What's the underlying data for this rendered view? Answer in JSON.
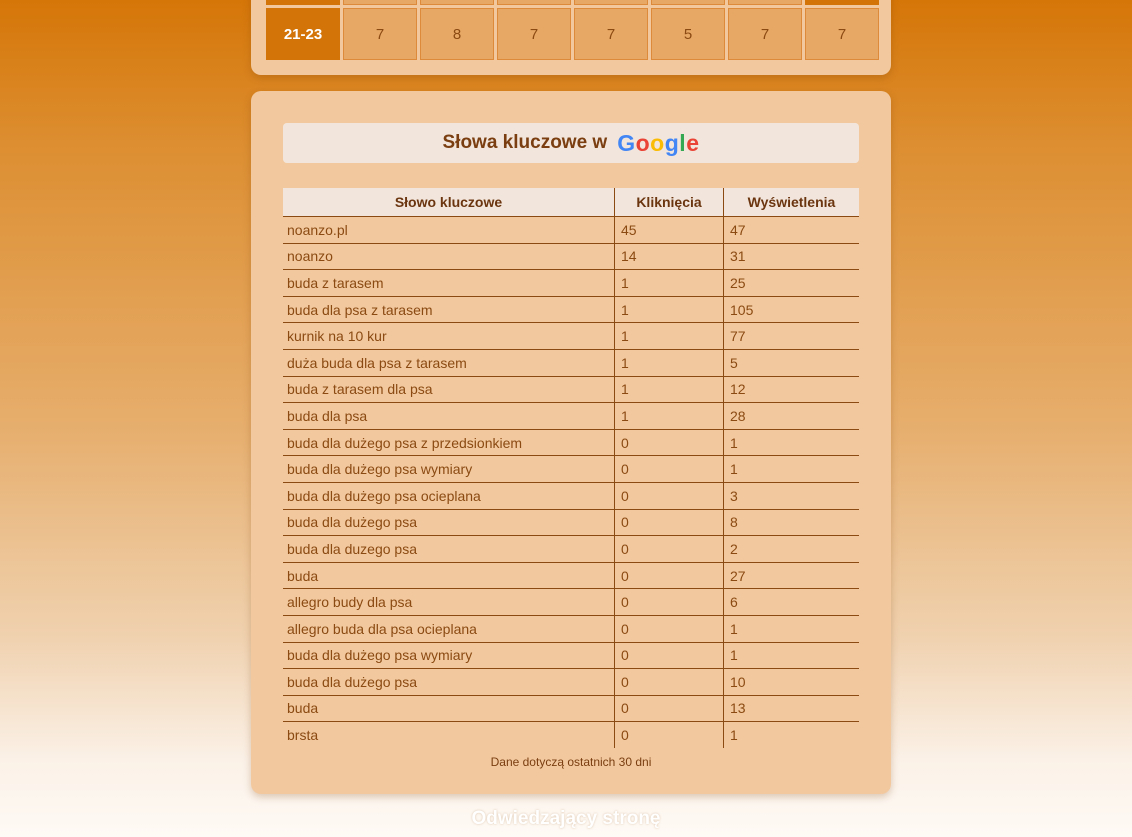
{
  "hours_panel": {
    "last_row": {
      "label": "21-23",
      "values": [
        "7",
        "8",
        "7",
        "7",
        "5",
        "7",
        "7"
      ]
    }
  },
  "keywords": {
    "title_prefix": "Słowa kluczowe w",
    "brand_letters": [
      "G",
      "o",
      "o",
      "g",
      "l",
      "e"
    ],
    "columns": [
      "Słowo kluczowe",
      "Kliknięcia",
      "Wyświetlenia"
    ],
    "rows": [
      [
        "noanzo.pl",
        "45",
        "47"
      ],
      [
        "noanzo",
        "14",
        "31"
      ],
      [
        "buda z tarasem",
        "1",
        "25"
      ],
      [
        "buda dla psa z tarasem",
        "1",
        "105"
      ],
      [
        "kurnik na 10 kur",
        "1",
        "77"
      ],
      [
        "duża buda dla psa z tarasem",
        "1",
        "5"
      ],
      [
        "buda z tarasem dla psa",
        "1",
        "12"
      ],
      [
        "buda dla psa",
        "1",
        "28"
      ],
      [
        "buda dla dużego psa z przedsionkiem",
        "0",
        "1"
      ],
      [
        "buda dla dużego psa wymiary",
        "0",
        "1"
      ],
      [
        "buda dla dużego psa ocieplana",
        "0",
        "3"
      ],
      [
        "buda dla dużego psa",
        "0",
        "8"
      ],
      [
        "buda dla duzego psa",
        "0",
        "2"
      ],
      [
        "buda",
        "0",
        "27"
      ],
      [
        "allegro budy dla psa",
        "0",
        "6"
      ],
      [
        "allegro buda dla psa ocieplana",
        "0",
        "1"
      ],
      [
        "buda dla dużego psa wymiary",
        "0",
        "1"
      ],
      [
        "buda dla dużego psa",
        "0",
        "10"
      ],
      [
        "buda",
        "0",
        "13"
      ],
      [
        "brsta",
        "0",
        "1"
      ]
    ],
    "footnote": "Dane dotyczą ostatnich 30 dni"
  },
  "visitors": {
    "heading": "Odwiedzający stronę"
  },
  "colors": {
    "accent": "#d27408",
    "panel": "#f2c99f",
    "cell": "#e8a865",
    "text": "#8b4a12"
  }
}
